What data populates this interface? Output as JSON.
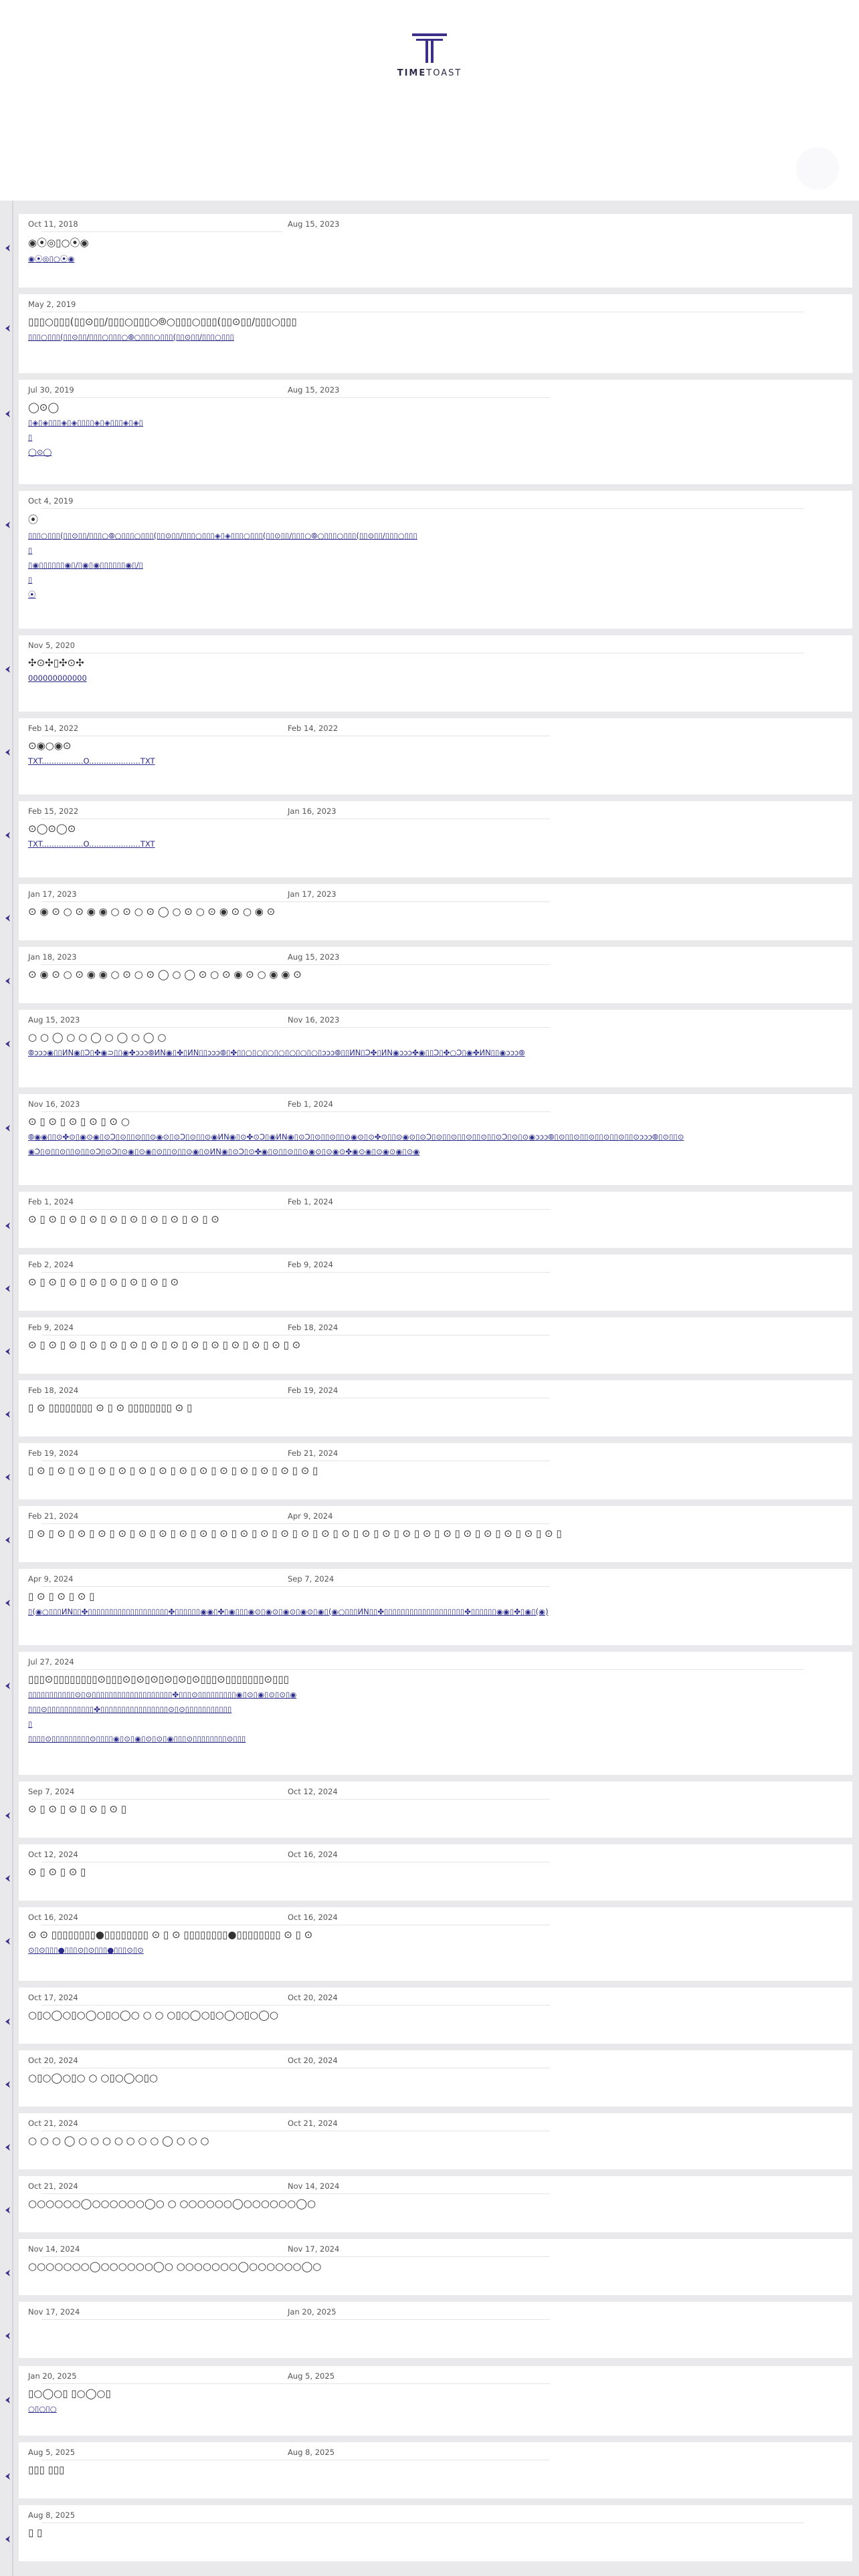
{
  "brand": {
    "name_bold": "TIME",
    "name_light": "TOAST",
    "accent": "#3b2f8a"
  },
  "events": [
    {
      "start": "Oct 11, 2018",
      "end": "Aug 15, 2023",
      "title": "◉⦿◎▯○⦿◉",
      "sub": [
        "◉⦿◎▯○⦿◉"
      ]
    },
    {
      "start": "May 2, 2019",
      "end": "",
      "title": "▯▯▯○▯▯▯(▯▯⊙▯▯/▯▯▯○▯▯▯○⦾○▯▯▯○▯▯▯(▯▯⊙▯▯/▯▯▯○▯▯▯",
      "sub": [
        "▯▯▯○▯▯▯(▯▯⊙▯▯/▯▯▯○▯▯▯○⦾○▯▯▯○▯▯▯(▯▯⊙▯▯/▯▯▯○▯▯▯"
      ]
    },
    {
      "start": "Jul 30, 2019",
      "end": "Aug 15, 2023",
      "title": "◯⊙◯",
      "sub": [
        "▯◈▯◈▯▯▯◈▯◈▯▯▯▯◈▯◈▯▯▯◈▯◈▯",
        "▯",
        "◯⊙◯"
      ]
    },
    {
      "start": "Oct 4, 2019",
      "end": "",
      "title": "⦿",
      "sub": [
        "▯▯▯○▯▯▯(▯▯⊙▯▯/▯▯▯○⦾○▯▯▯○▯▯▯(▯▯⊙▯▯/▯▯▯○▯▯▯◈▯◈▯▯▯○▯▯▯(▯▯⊙▯▯/▯▯▯○⦾○▯▯▯○▯▯▯(▯▯⊙▯▯/▯▯▯○▯▯▯",
        "▯",
        "▯◉▯▯▯▯▯▯◉▯/▯◉▯◉▯▯▯▯▯▯◉▯/▯",
        "▯",
        "⦿"
      ]
    },
    {
      "start": "Nov 5, 2020",
      "end": "",
      "title": "✣⊙✣▯✣⊙✣",
      "sub": [
        "000000000000"
      ]
    },
    {
      "start": "Feb 14, 2022",
      "end": "Feb 14, 2022",
      "title": "⊙◉○◉⊙",
      "sub": [
        "TXT.................O.....................TXT"
      ]
    },
    {
      "start": "Feb 15, 2022",
      "end": "Jan 16, 2023",
      "title": "⊙◯⊙◯⊙",
      "sub": [
        "TXT.................O.....................TXT"
      ]
    },
    {
      "start": "Jan 17, 2023",
      "end": "Jan 17, 2023",
      "title": "⊙ ◉ ⊙ ○ ⊙ ◉ ◉ ○ ⊙ ○ ⊙ ◯ ○ ⊙ ○ ⊙ ◉ ⊙ ○ ◉ ⊙",
      "sub": []
    },
    {
      "start": "Jan 18, 2023",
      "end": "Aug 15, 2023",
      "title": "⊙ ◉ ⊙ ○ ⊙ ◉ ◉ ○ ⊙ ○ ⊙ ◯ ○ ◯ ⊙ ○ ⊙ ◉ ⊙ ○ ◉ ◉ ⊙",
      "sub": []
    },
    {
      "start": "Aug 15, 2023",
      "end": "Nov 16, 2023",
      "title": "○ ○ ◯ ○ ○ ◯ ○ ◯ ○ ◯ ○",
      "sub": [
        "⦾ᴐᴐᴐ◉▯▯ИN◉▯Ɔ▯✤◉⊃▯▯◉✤ᴐᴐᴐ⦾ИN◉▯✤▯ИN▯▯ᴐᴐᴐ⦾▯✤▯▯○▯○▯○▯○▯○▯○▯○▯ᴐᴐᴐ⦾▯▯ИN▯Ɔ✤▯ИN◉ᴐᴐᴐ✤◉▯▯Ɔ▯✤○Ɔ▯◉✤ИN▯▯◉ᴐᴐᴐ⦾"
      ]
    },
    {
      "start": "Nov 16, 2023",
      "end": "Feb 1, 2024",
      "title": "⊙ ▯ ⊙ ▯ ⊙ ▯ ⊙ ▯ ⊙ ○",
      "sub": [
        "⦾◉◉▯▯⊙✤⊙▯◉⊙◉▯⊙Ɔ▯⊙▯▯⊙▯▯⊙◉⊙▯⊙Ɔ▯⊙▯▯⊙◉ИN◉▯⊙✤⊙Ɔ▯◉ИN◉▯⊙Ɔ▯⊙▯▯⊙▯▯⊙◉⊙▯⊙✤⊙▯▯⊙◉⊙▯⊙Ɔ▯⊙▯▯⊙▯▯⊙▯▯⊙▯▯⊙Ɔ▯⊙▯⊙◉ᴐᴐᴐ⦾▯⊙▯▯⊙▯▯⊙▯▯⊙▯▯⊙▯▯⊙ᴐᴐᴐ⦾▯⊙▯▯⊙",
        "◉Ɔ▯⊙▯▯⊙▯▯⊙▯▯⊙Ɔ▯⊙Ɔ▯⊙◉▯⊙◉▯⊙▯▯⊙▯▯⊙◉▯⊙ИN◉▯⊙Ɔ▯⊙✤◉▯⊙▯▯⊙▯▯⊙◉⊙▯⊙◉⊙✤◉⊙◉▯⊙◉⊙◉▯⊙◉"
      ]
    },
    {
      "start": "Feb 1, 2024",
      "end": "Feb 1, 2024",
      "title": "⊙ ▯ ⊙ ▯ ⊙ ▯ ⊙ ▯ ⊙ ▯ ⊙ ▯ ⊙ ▯ ⊙ ▯ ⊙ ▯ ⊙",
      "sub": []
    },
    {
      "start": "Feb 2, 2024",
      "end": "Feb 9, 2024",
      "title": "⊙ ▯ ⊙ ▯ ⊙ ▯ ⊙ ▯ ⊙ ▯ ⊙ ▯ ⊙ ▯ ⊙",
      "sub": []
    },
    {
      "start": "Feb 9, 2024",
      "end": "Feb 18, 2024",
      "title": "⊙ ▯ ⊙ ▯ ⊙ ▯ ⊙ ▯ ⊙ ▯ ⊙ ▯ ⊙ ▯ ⊙ ▯ ⊙ ▯ ⊙ ▯ ⊙ ▯ ⊙ ▯ ⊙ ▯ ⊙",
      "sub": []
    },
    {
      "start": "Feb 18, 2024",
      "end": "Feb 19, 2024",
      "title": "▯ ⊙ ▯▯▯▯▯▯▯▯ ⊙ ▯ ⊙ ▯▯▯▯▯▯▯▯ ⊙ ▯",
      "sub": []
    },
    {
      "start": "Feb 19, 2024",
      "end": "Feb 21, 2024",
      "title": "▯ ⊙ ▯ ⊙ ▯ ⊙ ▯ ⊙ ▯ ⊙ ▯ ⊙ ▯ ⊙ ▯ ⊙ ▯ ⊙ ▯ ⊙ ▯ ⊙ ▯ ⊙ ▯ ⊙ ▯ ⊙ ▯",
      "sub": []
    },
    {
      "start": "Feb 21, 2024",
      "end": "Apr 9, 2024",
      "title": "▯ ⊙ ▯ ⊙ ▯ ⊙ ▯ ⊙ ▯ ⊙ ▯ ⊙ ▯ ⊙ ▯ ⊙ ▯ ⊙ ▯ ⊙ ▯ ⊙ ▯ ⊙ ▯ ⊙ ▯ ⊙ ▯ ⊙ ▯ ⊙ ▯ ⊙ ▯ ⊙ ▯ ⊙ ▯ ⊙ ▯ ⊙ ▯ ⊙ ▯ ⊙ ▯ ⊙ ▯ ⊙ ▯ ⊙ ▯",
      "sub": []
    },
    {
      "start": "Apr 9, 2024",
      "end": "Sep 7, 2024",
      "title": "▯ ⊙ ▯ ⊙ ▯ ⊙ ▯",
      "sub": [
        "▯(◉○▯▯▯ИN▯▯✤▯▯▯▯▯▯▯▯▯▯▯▯▯▯▯▯▯▯▯✤▯▯▯▯▯▯◉◉▯✤▯◉▯▯▯◉⊙▯◉⊙▯◉⊙▯◉⊙▯◉▯(◉○▯▯▯ИN▯▯✤▯▯▯▯▯▯▯▯▯▯▯▯▯▯▯▯▯▯▯✤▯▯▯▯▯▯◉◉▯✤▯◉▯(◉)"
      ]
    },
    {
      "start": "Jul 27, 2024",
      "end": "",
      "title": "▯▯▯⊙▯▯▯▯▯▯▯▯⊙▯▯▯⊙▯⊙▯⊙▯⊙▯⊙▯⊙▯▯▯⊙▯▯▯▯▯▯▯⊙▯▯▯",
      "sub": [
        "▯▯▯▯▯▯▯▯▯▯▯⊙▯⊙▯▯▯▯▯▯▯▯▯▯▯▯▯▯▯▯▯▯▯✤▯▯▯⊙▯▯▯▯▯▯▯▯▯◉▯⊙▯◉▯⊙▯⊙▯◉",
        "▯▯▯⊙▯▯▯▯▯▯▯▯▯▯▯✤▯▯▯▯▯▯▯▯▯▯▯▯▯▯▯▯⊙▯⊙▯▯▯▯▯▯▯▯▯▯▯",
        "▯",
        "▯▯▯▯⊙▯▯▯▯▯▯▯▯▯⊙▯▯▯▯◉▯⊙▯◉▯⊙▯⊙▯◉▯▯▯⊙▯▯▯▯▯▯▯▯⊙▯▯▯"
      ]
    },
    {
      "start": "Sep 7, 2024",
      "end": "Oct 12, 2024",
      "title": "⊙ ▯ ⊙ ▯ ⊙ ▯ ⊙ ▯ ⊙ ▯",
      "sub": []
    },
    {
      "start": "Oct 12, 2024",
      "end": "Oct 16, 2024",
      "title": "⊙ ▯ ⊙ ▯ ⊙ ▯",
      "sub": []
    },
    {
      "start": "Oct 16, 2024",
      "end": "Oct 16, 2024",
      "title": "⊙ ⊙ ▯▯▯▯▯▯▯▯●▯▯▯▯▯▯▯▯ ⊙ ▯ ⊙ ▯▯▯▯▯▯▯▯●▯▯▯▯▯▯▯▯ ⊙ ▯ ⊙",
      "sub": [
        "⊙▯⊙▯▯▯●▯▯▯⊙▯⊙▯▯▯●▯▯▯⊙▯⊙"
      ]
    },
    {
      "start": "Oct 17, 2024",
      "end": "Oct 20, 2024",
      "title": "○▯○◯○▯○◯○▯○◯○      ○ ○      ○▯○◯○▯○◯○▯○◯○",
      "sub": []
    },
    {
      "start": "Oct 20, 2024",
      "end": "Oct 20, 2024",
      "title": "○▯○◯○▯○   ○   ○▯○◯○▯○",
      "sub": []
    },
    {
      "start": "Oct 21, 2024",
      "end": "Oct 21, 2024",
      "title": "○ ○ ○ ◯ ○ ○ ○   ○   ○ ○ ○ ◯ ○ ○ ○",
      "sub": []
    },
    {
      "start": "Oct 21, 2024",
      "end": "Nov 14, 2024",
      "title": "○○○○○○◯○○○○○○◯○          ○          ○○○○○○◯○○○○○○◯○",
      "sub": []
    },
    {
      "start": "Nov 14, 2024",
      "end": "Nov 17, 2024",
      "title": "○○○○○○○◯○○○○○○◯○                    ○○○○○○○◯○○○○○○◯○",
      "sub": []
    },
    {
      "start": "Nov 17, 2024",
      "end": "Jan 20, 2025",
      "title": "",
      "sub": []
    },
    {
      "start": "Jan 20, 2025",
      "end": "Aug 5, 2025",
      "title": "▯○◯○▯        ▯○◯○▯",
      "sub": [
        "○▯○▯○"
      ]
    },
    {
      "start": "Aug 5, 2025",
      "end": "Aug 8, 2025",
      "title": "▯▯▯  ▯▯▯",
      "sub": []
    },
    {
      "start": "Aug 8, 2025",
      "end": "",
      "title": "▯  ▯",
      "sub": []
    }
  ]
}
